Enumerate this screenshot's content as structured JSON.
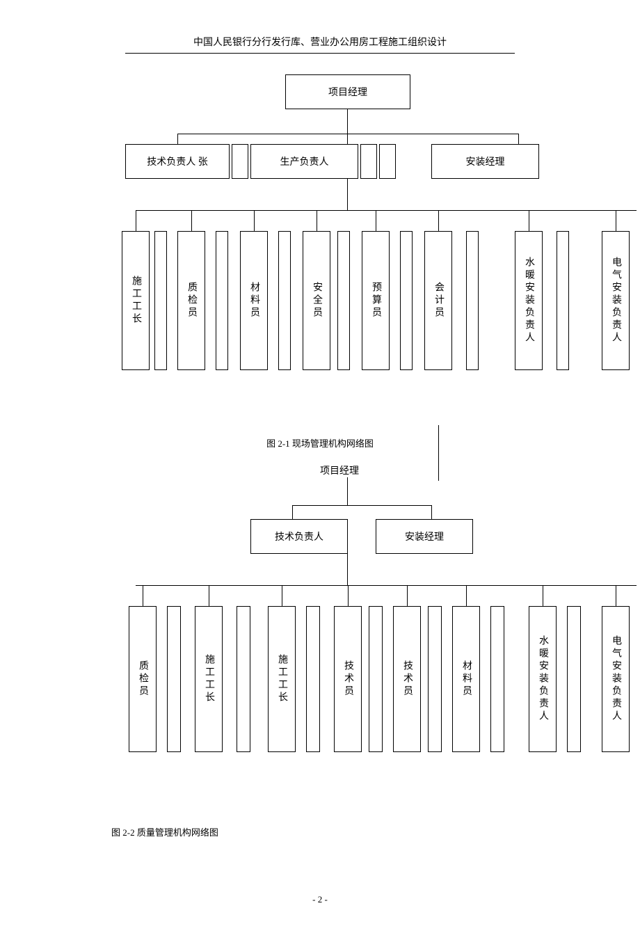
{
  "header_title": "中国人民银行分行发行库、营业办公用房工程施工组织设计",
  "chart1": {
    "top": "项目经理",
    "mid": [
      "技术负责人 张",
      "生产负责人",
      "安装经理"
    ],
    "bottom": [
      "施工工长",
      "质检员",
      "材料员",
      "安全员",
      "预算员",
      "会计员",
      "水暖安装负责人",
      "电气安装负责人"
    ],
    "caption": "图 2-1 现场管理机构网络图"
  },
  "chart2": {
    "top": "项目经理",
    "mid": [
      "技术负责人",
      "安装经理"
    ],
    "bottom": [
      "质检员",
      "施工工长",
      "施工工长",
      "技术员",
      "技术员",
      "材料员",
      "水暖安装负责人",
      "电气安装负责人"
    ],
    "caption": "图 2-2 质量管理机构网络图"
  },
  "page_number": "- 2 -",
  "chart_data": [
    {
      "type": "tree",
      "title": "图 2-1 现场管理机构网络图",
      "root": "项目经理",
      "children": [
        {
          "name": "技术负责人 张"
        },
        {
          "name": "生产负责人",
          "children": [
            "施工工长",
            "质检员",
            "材料员",
            "安全员",
            "预算员",
            "会计员",
            "水暖安装负责人",
            "电气安装负责人"
          ]
        },
        {
          "name": "安装经理"
        }
      ]
    },
    {
      "type": "tree",
      "title": "图 2-2 质量管理机构网络图",
      "root": "项目经理",
      "children": [
        {
          "name": "技术负责人"
        },
        {
          "name": "安装经理"
        }
      ],
      "bottom_shared": [
        "质检员",
        "施工工长",
        "施工工长",
        "技术员",
        "技术员",
        "材料员",
        "水暖安装负责人",
        "电气安装负责人"
      ]
    }
  ]
}
